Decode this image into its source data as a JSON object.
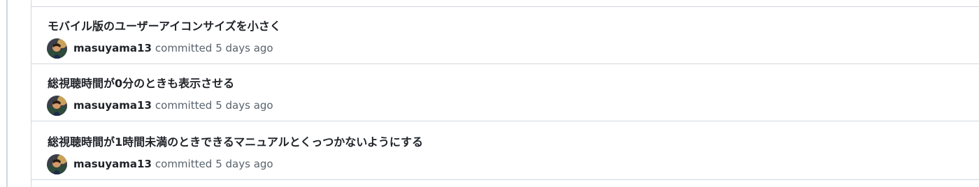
{
  "commits": [
    {
      "title": "モバイル版のユーザーアイコンサイズを小さく",
      "author": "masuyama13",
      "verb": "committed",
      "time": "5 days ago"
    },
    {
      "title": "総視聴時間が0分のときも表示させる",
      "author": "masuyama13",
      "verb": "committed",
      "time": "5 days ago"
    },
    {
      "title": "総視聴時間が1時間未満のときできるマニュアルとくっつかないようにする",
      "author": "masuyama13",
      "verb": "committed",
      "time": "5 days ago"
    }
  ],
  "colors": {
    "border": "#d0d7de",
    "text_primary": "#1f2328",
    "text_muted": "#59636e"
  }
}
